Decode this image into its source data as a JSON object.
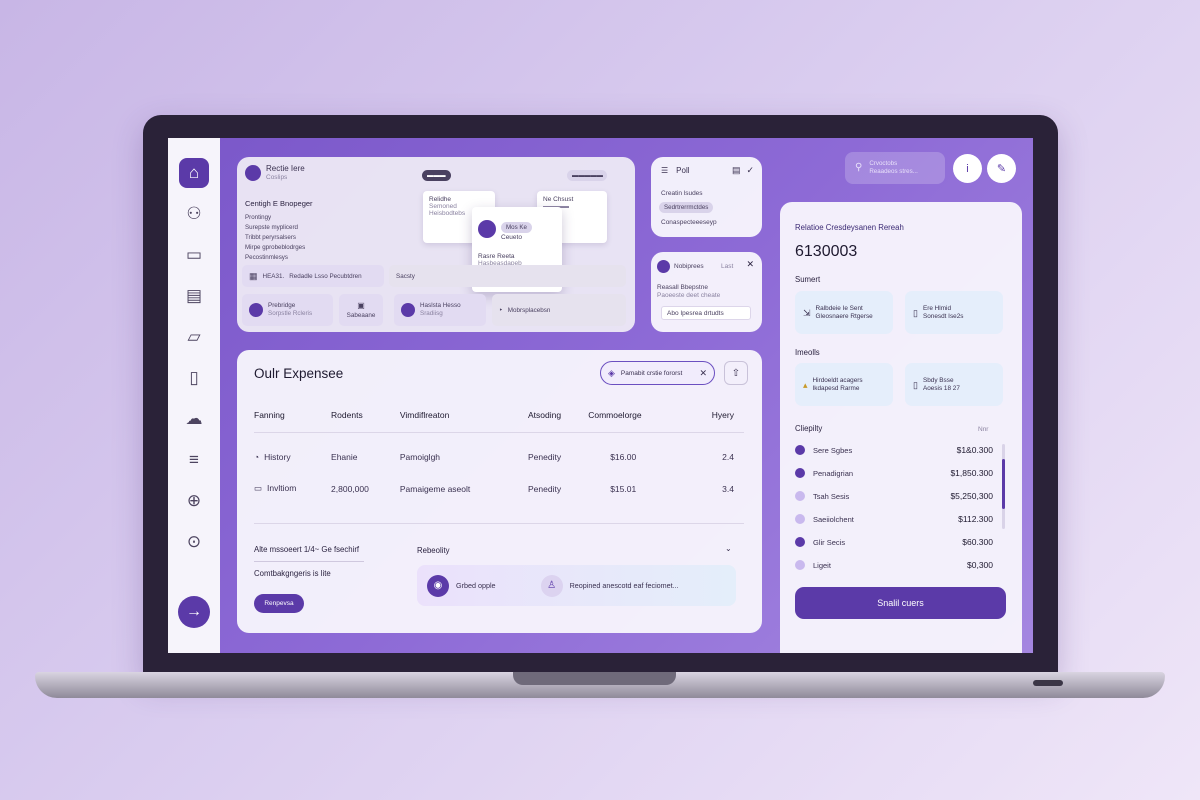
{
  "sidebar": {
    "items": [
      {
        "icon": "dashboard-icon",
        "glyph": "⌂"
      },
      {
        "icon": "users-icon",
        "glyph": "⚇"
      },
      {
        "icon": "inbox-icon",
        "glyph": "▭"
      },
      {
        "icon": "book-icon",
        "glyph": "▤"
      },
      {
        "icon": "folder-icon",
        "glyph": "▱"
      },
      {
        "icon": "document-icon",
        "glyph": "▯"
      },
      {
        "icon": "team-icon",
        "glyph": "☁"
      },
      {
        "icon": "printer-icon",
        "glyph": "≡"
      },
      {
        "icon": "globe-icon",
        "glyph": "⊕"
      },
      {
        "icon": "download-icon",
        "glyph": "⊙"
      }
    ],
    "go_glyph": "→"
  },
  "card1": {
    "head_title": "Rectie Iere",
    "head_sub": "Coslips",
    "section_title": "Centigh E Bnopeger",
    "list": [
      "Prontingy",
      "Surepste myplicerd",
      "Tribbt peryrsalsers",
      "Mirpe gprobeblodrges",
      "Pecostinmlesys"
    ],
    "chip_a": "▬▬▬",
    "chip_b": "▬▬▬▬▬",
    "mini1_title": "Relidhe",
    "mini1_lines": [
      "Semoned",
      "Heisbodtebs"
    ],
    "mini2_title": "Ne Chsust",
    "mini2_lines": [
      "▬▬▬▬"
    ],
    "popup_chip": "Mos Ke",
    "popup_title": "Ceueto",
    "popup_lines": [
      "Rasre Reeta",
      "Hasbeasdapeb"
    ],
    "bar1_label": "HEA31.",
    "bar1_text": "Redadle Lsso Pecubtdren",
    "bar2_text": "Sacsty",
    "row1_title": "Prebridge",
    "row1_sub": "Sorpstle Rcleris",
    "row2_text": "Sabeaane",
    "row3_title": "Haslsta Hesso",
    "row3_sub": "Sradiisg",
    "row4_text": "Mobrsplacebsn"
  },
  "card2": {
    "label": "Poll",
    "line1": "Creatin lsudes",
    "chip": "Sedrtrerrmctdes",
    "line2": "Conaspecteeeseyp"
  },
  "card3": {
    "label": "Nobiprees",
    "tag": "Last",
    "title": "Reasall Bbepstne",
    "sub": "Paoeeste deet cheate",
    "input": "Abo Ipesrea drtudts"
  },
  "main": {
    "title": "Oulr Expensee",
    "filter_label": "Pamabit crstie fororst",
    "columns": [
      "Fanning",
      "Rodents",
      "Vimdiflreaton",
      "Atsoding",
      "Commoelorge",
      "Hyery"
    ],
    "rows": [
      [
        "History",
        "Ehanie",
        "Pamoiglgh",
        "Penedity",
        "$16.00",
        "2.4"
      ],
      [
        "Invltiom",
        "2,800,000",
        "Pamaigeme aseolt",
        "Penedity",
        "$15.01",
        "3.4"
      ]
    ],
    "foot_title": "Alte mssoeert 1/4~ Ge fsechirf",
    "foot_sub": "Comtbakgngeris is lite",
    "foot_btn": "Renpevsa",
    "foot_right_title": "Rebeolity",
    "foot_caret": "⌄",
    "box_left": "Grbed opple",
    "box_right": "Reopined anescotd eaf feciomet..."
  },
  "topbar": {
    "search_line1": "Crvoctobs",
    "search_line2": "Reaadeos stres..."
  },
  "right": {
    "title": "Relatioe Cresdeysanen Rereah",
    "value": "6130003",
    "section1": "Sumert",
    "tiles1": [
      {
        "line1": "Ralbdeie Ie Sent",
        "line2": "Gleosnaere Rtgerse"
      },
      {
        "line1": "Ere Hlmid",
        "line2": "Sonesdt Ise2s"
      }
    ],
    "section2": "Imeolls",
    "tiles2": [
      {
        "line1": "Hirdoeldt acagers",
        "line2": "Ikdapesd Rarme"
      },
      {
        "line1": "Sbdy Bsse",
        "line2": "Aoesis 18 27"
      }
    ],
    "section3": "Cliepilty",
    "section3_right": "Nnr",
    "list": [
      {
        "label": "Sere Sgbes",
        "amount": "$1&0.300"
      },
      {
        "label": "Penadigrian",
        "amount": "$1,850.300"
      },
      {
        "label": "Tsah Sesis",
        "amount": "$5,250,300"
      },
      {
        "label": "Saeiiolchent",
        "amount": "$112.300"
      },
      {
        "label": "Glir Secis",
        "amount": "$60.300"
      },
      {
        "label": "Ligeit",
        "amount": "$0,300"
      }
    ],
    "cta": "Snalil cuers"
  },
  "colors": {
    "accent": "#5b3aa8",
    "screen_bg": "#8d6ad6",
    "card_bg": "#f7f5fc"
  }
}
